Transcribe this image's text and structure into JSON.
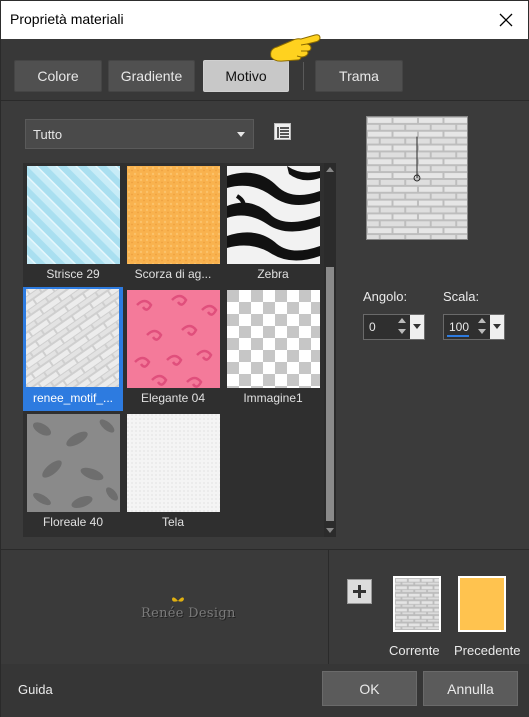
{
  "window": {
    "title": "Proprietà materiali",
    "close_icon": "close-icon"
  },
  "tabs": [
    {
      "label": "Colore",
      "active": false
    },
    {
      "label": "Gradiente",
      "active": false
    },
    {
      "label": "Motivo",
      "active": true
    },
    {
      "label": "Trama",
      "active": false
    }
  ],
  "category": {
    "selected": "Tutto"
  },
  "patterns": [
    {
      "label": "Strisce 29",
      "selected": false
    },
    {
      "label": "Scorza di ag...",
      "selected": false
    },
    {
      "label": "Zebra",
      "selected": false
    },
    {
      "label": "renee_motif_...",
      "selected": true
    },
    {
      "label": "Elegante 04",
      "selected": false
    },
    {
      "label": "Immagine1",
      "selected": false
    },
    {
      "label": "Floreale 40",
      "selected": false
    },
    {
      "label": "Tela",
      "selected": false
    }
  ],
  "angle": {
    "label": "Angolo:",
    "value": "0"
  },
  "scale": {
    "label": "Scala:",
    "value": "100"
  },
  "logo": {
    "text": "Renée Design"
  },
  "swatches": {
    "current_label": "Corrente",
    "previous_label": "Precedente",
    "previous_color": "#ffc34f"
  },
  "footer": {
    "help": "Guida",
    "ok": "OK",
    "cancel": "Annulla"
  },
  "colors": {
    "accent": "#2d7be0",
    "background": "#3a3a3a",
    "active_tab": "#c8c8c8"
  }
}
